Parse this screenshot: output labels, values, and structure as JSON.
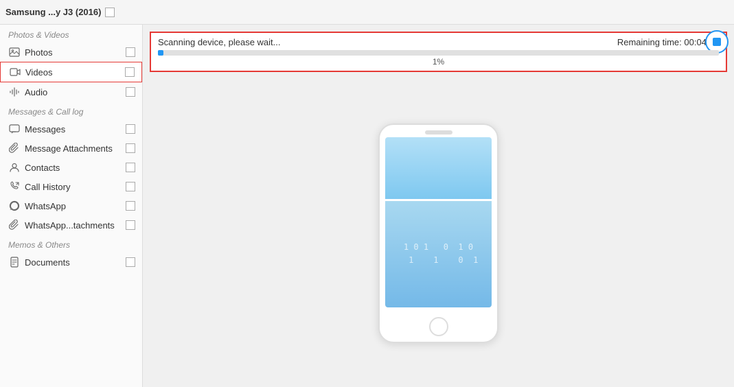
{
  "header": {
    "device_name": "Samsung ...y J3 (2016)"
  },
  "scan": {
    "status_text": "Scanning device, please wait...",
    "remaining_label": "Remaining time:",
    "remaining_time": "00:04:27",
    "progress_percent": 1,
    "progress_label": "1%"
  },
  "sidebar": {
    "section_photos_videos": "Photos & Videos",
    "section_messages": "Messages & Call log",
    "section_memos": "Memos & Others",
    "items": [
      {
        "id": "photos",
        "label": "Photos",
        "icon": "🖼",
        "checked": false,
        "selected": false
      },
      {
        "id": "videos",
        "label": "Videos",
        "icon": "🎞",
        "checked": false,
        "selected": true
      },
      {
        "id": "audio",
        "label": "Audio",
        "icon": "♪",
        "checked": false,
        "selected": false
      },
      {
        "id": "messages",
        "label": "Messages",
        "icon": "✉",
        "checked": false,
        "selected": false
      },
      {
        "id": "message-attachments",
        "label": "Message Attachments",
        "icon": "📎",
        "checked": false,
        "selected": false
      },
      {
        "id": "contacts",
        "label": "Contacts",
        "icon": "👤",
        "checked": false,
        "selected": false
      },
      {
        "id": "call-history",
        "label": "Call History",
        "icon": "📞",
        "checked": false,
        "selected": false
      },
      {
        "id": "whatsapp",
        "label": "WhatsApp",
        "icon": "💬",
        "checked": false,
        "selected": false
      },
      {
        "id": "whatsapp-attachments",
        "label": "WhatsApp...tachments",
        "icon": "📎",
        "checked": false,
        "selected": false
      },
      {
        "id": "documents",
        "label": "Documents",
        "icon": "📄",
        "checked": false,
        "selected": false
      }
    ]
  },
  "phone_illustration": {
    "binary_lines": [
      "1  0  1    0   1  0",
      "   1    1    0   1"
    ]
  },
  "stop_button_label": "Stop"
}
